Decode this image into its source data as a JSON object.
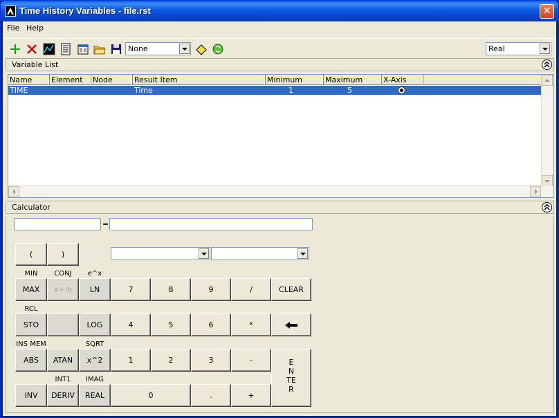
{
  "window": {
    "title": "Time History Variables - file.rst",
    "close_label": "✕"
  },
  "menu": {
    "file": "File",
    "help": "Help"
  },
  "toolbar": {
    "dropdown_value": "None",
    "type_dropdown_value": "Real"
  },
  "variable_list": {
    "title": "Variable List",
    "columns": [
      "Name",
      "Element",
      "Node",
      "Result Item",
      "Minimum",
      "Maximum",
      "X-Axis"
    ],
    "rows": [
      {
        "name": "TIME",
        "element": "",
        "node": "",
        "result_item": "Time",
        "minimum": "1",
        "maximum": "5",
        "x_axis": true
      }
    ]
  },
  "calculator": {
    "title": "Calculator",
    "equals": "=",
    "buttons": {
      "lparen": "(",
      "rparen": ")",
      "max": "MAX",
      "complex": "a+ib",
      "ln": "LN",
      "n7": "7",
      "n8": "8",
      "n9": "9",
      "div": "/",
      "clear": "CLEAR",
      "sto": "STO",
      "log": "LOG",
      "n4": "4",
      "n5": "5",
      "n6": "6",
      "mul": "*",
      "abs": "ABS",
      "atan": "ATAN",
      "sq": "x^2",
      "n1": "1",
      "n2": "2",
      "n3": "3",
      "sub": "-",
      "enter": "ENTER",
      "inv": "INV",
      "deriv": "DERIV",
      "real": "REAL",
      "n0": "0",
      "dot": ".",
      "add": "+"
    },
    "shift_labels": {
      "min": "MIN",
      "conj": "CONJ",
      "exp": "e^x",
      "rcl": "RCL",
      "ins_mem": "INS MEM",
      "sqrt": "SQRT",
      "int1": "INT1",
      "imag": "IMAG"
    }
  }
}
